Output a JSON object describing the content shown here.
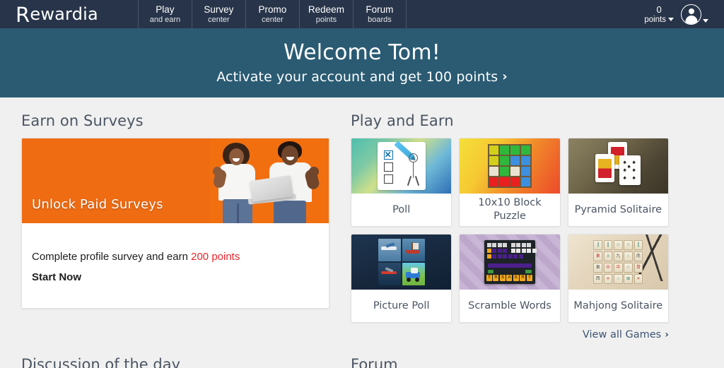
{
  "header": {
    "logo_text": "Rewardia",
    "logo_initial": "R",
    "logo_rest": "ewardia",
    "nav": [
      {
        "top": "Play",
        "sub": "and earn"
      },
      {
        "top": "Survey",
        "sub": "center"
      },
      {
        "top": "Promo",
        "sub": "center"
      },
      {
        "top": "Redeem",
        "sub": "points"
      },
      {
        "top": "Forum",
        "sub": "boards"
      }
    ],
    "points_value": "0",
    "points_label": "points",
    "avatar_icon": "user-avatar-icon",
    "caret_icon": "chevron-down-icon"
  },
  "banner": {
    "title": "Welcome Tom!",
    "subtitle": "Activate your account and get 100 points",
    "chevron": "›",
    "bg_color": "#2a5b73"
  },
  "surveys": {
    "section_title": "Earn on Surveys",
    "hero_title": "Unlock Paid Surveys",
    "body_text_before": "Complete profile survey and earn ",
    "body_points": "200 points",
    "start_label": "Start Now",
    "points_color": "#e8252a",
    "hero_color": "#ef6c13"
  },
  "games": {
    "section_title": "Play and Earn",
    "items": [
      {
        "label": "Poll",
        "thumb": "poll-thumb"
      },
      {
        "label": "10x10 Block Puzzle",
        "thumb": "block-puzzle-thumb"
      },
      {
        "label": "Pyramid Solitaire",
        "thumb": "pyramid-solitaire-thumb"
      },
      {
        "label": "Picture Poll",
        "thumb": "picture-poll-thumb"
      },
      {
        "label": "Scramble Words",
        "thumb": "scramble-words-thumb"
      },
      {
        "label": "Mahjong Solitaire",
        "thumb": "mahjong-solitaire-thumb"
      }
    ],
    "view_all_label": "View all Games",
    "view_all_chevron": "›"
  },
  "bottom": {
    "discussion_title": "Discussion of the day",
    "forum_title": "Forum"
  }
}
